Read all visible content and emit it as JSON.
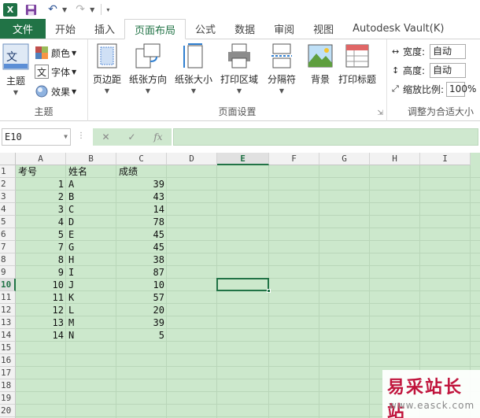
{
  "qat": {
    "logo": "X",
    "undo": "↶",
    "redo": "↷"
  },
  "tabs": [
    {
      "label": "文件"
    },
    {
      "label": "开始"
    },
    {
      "label": "插入"
    },
    {
      "label": "页面布局"
    },
    {
      "label": "公式"
    },
    {
      "label": "数据"
    },
    {
      "label": "审阅"
    },
    {
      "label": "视图"
    },
    {
      "label": "Autodesk Vault(K)"
    }
  ],
  "ribbon": {
    "theme_group": {
      "label": "主题",
      "theme_button": "主题",
      "colors": "颜色",
      "fonts": "字体",
      "effects": "效果"
    },
    "page_setup_group": {
      "label": "页面设置",
      "margins": "页边距",
      "orientation": "纸张方向",
      "size": "纸张大小",
      "print_area": "打印区域",
      "breaks": "分隔符",
      "background": "背景",
      "print_titles": "打印标题"
    },
    "scale_group": {
      "label": "调整为合适大小",
      "width_label": "宽度:",
      "width_value": "自动",
      "height_label": "高度:",
      "height_value": "自动",
      "scale_label": "缩放比例:",
      "scale_value": "100%"
    }
  },
  "formula_bar": {
    "name_box": "E10",
    "cancel": "✕",
    "enter": "✓",
    "fx": "fx",
    "value": ""
  },
  "sheet": {
    "columns": [
      "A",
      "B",
      "C",
      "D",
      "E",
      "F",
      "G",
      "H",
      "I"
    ],
    "selected_column": "E",
    "selected_row": 10,
    "row_count": 21,
    "headers": {
      "id": "考号",
      "name": "姓名",
      "score": "成绩"
    },
    "rows": [
      {
        "id": 1,
        "name": "A",
        "score": 39
      },
      {
        "id": 2,
        "name": "B",
        "score": 43
      },
      {
        "id": 3,
        "name": "C",
        "score": 14
      },
      {
        "id": 4,
        "name": "D",
        "score": 78
      },
      {
        "id": 5,
        "name": "E",
        "score": 45
      },
      {
        "id": 7,
        "name": "G",
        "score": 45
      },
      {
        "id": 8,
        "name": "H",
        "score": 38
      },
      {
        "id": 9,
        "name": "I",
        "score": 87
      },
      {
        "id": 10,
        "name": "J",
        "score": 10
      },
      {
        "id": 11,
        "name": "K",
        "score": 57
      },
      {
        "id": 12,
        "name": "L",
        "score": 20
      },
      {
        "id": 13,
        "name": "M",
        "score": 39
      },
      {
        "id": 14,
        "name": "N",
        "score": 5
      }
    ]
  },
  "watermark": {
    "text": "易采站长站",
    "url": "www.easck.com"
  }
}
